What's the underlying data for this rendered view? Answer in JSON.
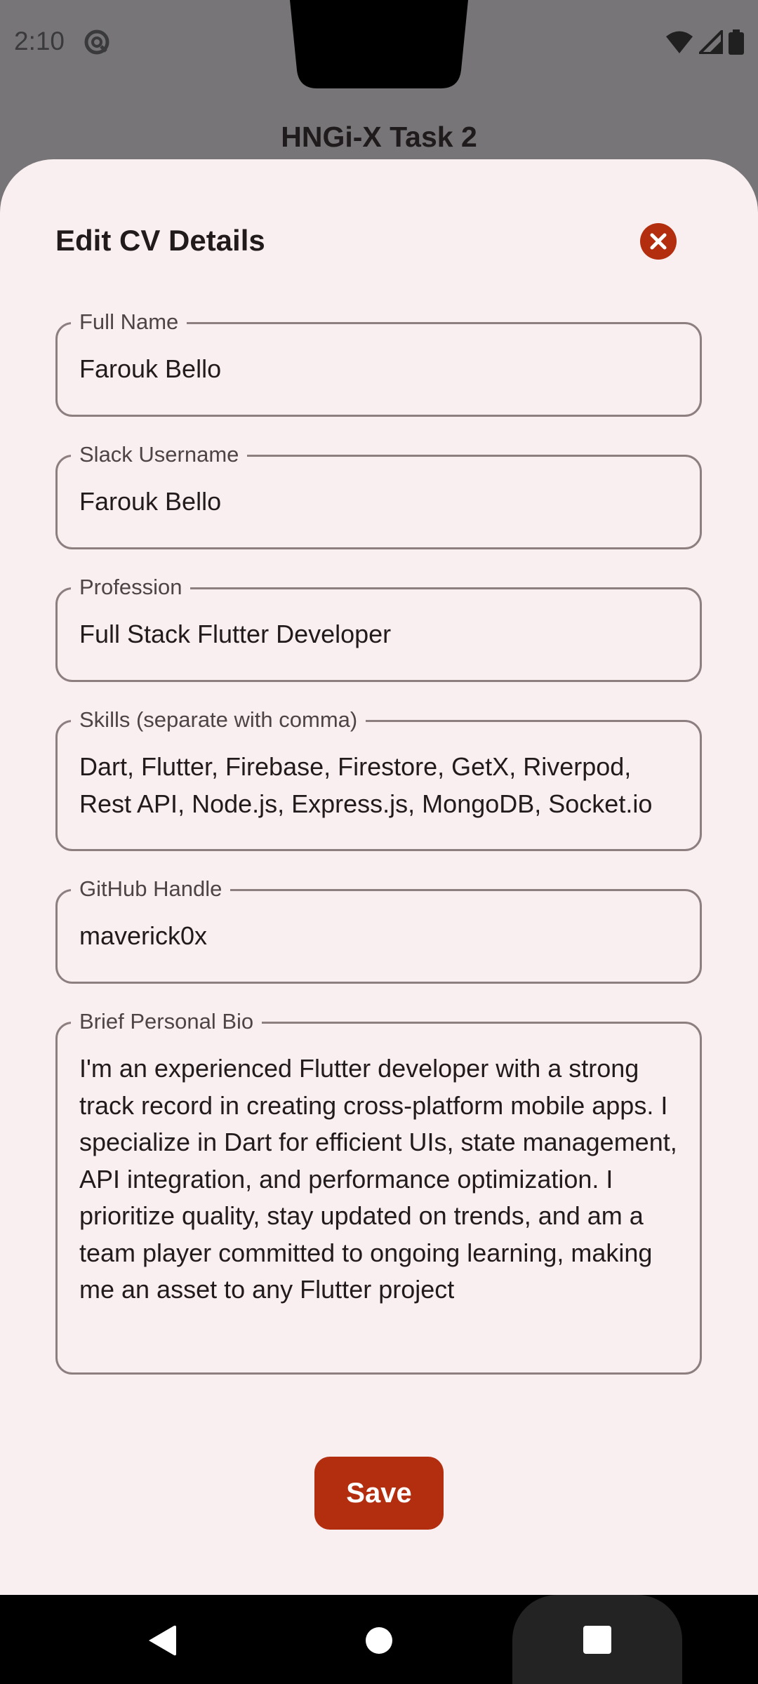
{
  "status_bar": {
    "time": "2:10",
    "icons": [
      "at-sign-icon",
      "wifi-icon",
      "signal-icon",
      "battery-icon"
    ]
  },
  "app": {
    "title": "HNGi-X Task 2"
  },
  "sheet": {
    "title": "Edit CV Details",
    "close_icon": "close-circle-icon",
    "accent_color": "#b32d0f",
    "fields": [
      {
        "label": "Full Name",
        "value": "Farouk Bello"
      },
      {
        "label": "Slack Username",
        "value": "Farouk Bello"
      },
      {
        "label": "Profession",
        "value": "Full Stack Flutter Developer"
      },
      {
        "label": "Skills (separate with comma)",
        "value": "Dart, Flutter, Firebase, Firestore, GetX, Riverpod, Rest API, Node.js, Express.js, MongoDB, Socket.io"
      },
      {
        "label": "GitHub Handle",
        "value": "maverick0x"
      },
      {
        "label": "Brief Personal Bio",
        "value": "I'm an experienced Flutter developer with a strong track record in creating cross-platform mobile apps. I specialize in Dart for efficient UIs, state management, API integration, and performance optimization. I prioritize quality, stay updated on trends, and am a team player committed to ongoing learning, making me an asset to any Flutter project"
      }
    ],
    "save_label": "Save"
  },
  "nav_bar": {
    "icons": [
      "back-icon",
      "home-icon",
      "recents-icon"
    ]
  }
}
